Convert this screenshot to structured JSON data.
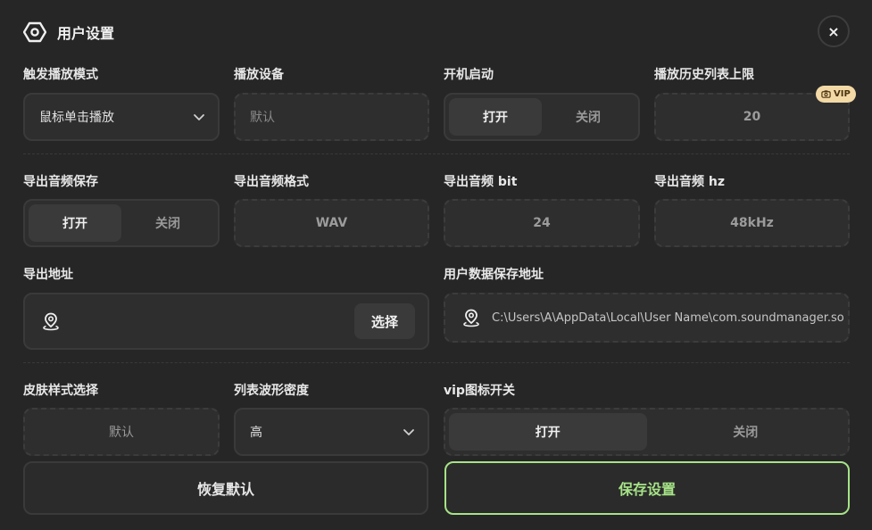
{
  "header": {
    "title": "用户设置",
    "close_label": "×"
  },
  "row1": {
    "trigger_mode": {
      "label": "触发播放模式",
      "value": "鼠标单击播放"
    },
    "playback_device": {
      "label": "播放设备",
      "placeholder": "默认"
    },
    "autostart": {
      "label": "开机启动",
      "on": "打开",
      "off": "关闭",
      "selected": "on"
    },
    "history_limit": {
      "label": "播放历史列表上限",
      "value": "20",
      "badge": "VIP"
    }
  },
  "row2": {
    "export_save": {
      "label": "导出音频保存",
      "on": "打开",
      "off": "关闭",
      "selected": "on"
    },
    "export_format": {
      "label": "导出音频格式",
      "value": "WAV"
    },
    "export_bit": {
      "label": "导出音频 bit",
      "value": "24"
    },
    "export_hz": {
      "label": "导出音频 hz",
      "value": "48kHz"
    }
  },
  "row3": {
    "export_path": {
      "label": "导出地址",
      "value": "",
      "choose_label": "选择"
    },
    "user_data_path": {
      "label": "用户数据保存地址",
      "value": "C:\\Users\\A\\AppData\\Local\\User Name\\com.soundmanager.so"
    }
  },
  "row4": {
    "skin": {
      "label": "皮肤样式选择",
      "value": "默认"
    },
    "wave_density": {
      "label": "列表波形密度",
      "value": "高"
    },
    "vip_icon": {
      "label": "vip图标开关",
      "on": "打开",
      "off": "关闭",
      "selected": "on"
    }
  },
  "actions": {
    "reset_label": "恢复默认",
    "save_label": "保存设置"
  },
  "colors": {
    "accent": "#a6e387",
    "vip_badge": "#f3d9a6",
    "panel": "#262626"
  }
}
